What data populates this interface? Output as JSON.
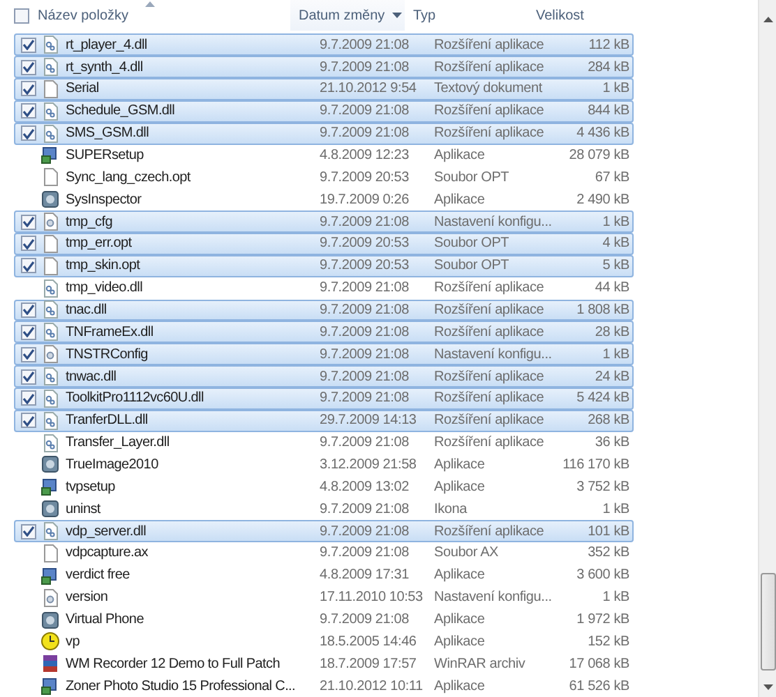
{
  "columns": [
    {
      "label": "Název položky",
      "sorted": true,
      "checked": false
    },
    {
      "label": "Datum změny",
      "hover": true
    },
    {
      "label": "Typ"
    },
    {
      "label": "Velikost"
    }
  ],
  "rows": [
    {
      "name": "rt_player_4.dll",
      "date": "9.7.2009 21:08",
      "type": "Rozšíření aplikace",
      "size": "112 kB",
      "kind": "dll",
      "selected": true
    },
    {
      "name": "rt_synth_4.dll",
      "date": "9.7.2009 21:08",
      "type": "Rozšíření aplikace",
      "size": "284 kB",
      "kind": "dll",
      "selected": true
    },
    {
      "name": "Serial",
      "date": "21.10.2012 9:54",
      "type": "Textový dokument",
      "size": "1 kB",
      "kind": "doc",
      "selected": true
    },
    {
      "name": "Schedule_GSM.dll",
      "date": "9.7.2009 21:08",
      "type": "Rozšíření aplikace",
      "size": "844 kB",
      "kind": "dll",
      "selected": true
    },
    {
      "name": "SMS_GSM.dll",
      "date": "9.7.2009 21:08",
      "type": "Rozšíření aplikace",
      "size": "4 436 kB",
      "kind": "dll",
      "selected": true
    },
    {
      "name": "SUPERsetup",
      "date": "4.8.2009 12:23",
      "type": "Aplikace",
      "size": "28 079 kB",
      "kind": "setup",
      "selected": false
    },
    {
      "name": "Sync_lang_czech.opt",
      "date": "9.7.2009 20:53",
      "type": "Soubor OPT",
      "size": "67 kB",
      "kind": "doc",
      "selected": false
    },
    {
      "name": "SysInspector",
      "date": "19.7.2009 0:26",
      "type": "Aplikace",
      "size": "2 490 kB",
      "kind": "app",
      "selected": false
    },
    {
      "name": "tmp_cfg",
      "date": "9.7.2009 21:08",
      "type": "Nastavení konfigu...",
      "size": "1 kB",
      "kind": "config",
      "selected": true
    },
    {
      "name": "tmp_err.opt",
      "date": "9.7.2009 20:53",
      "type": "Soubor OPT",
      "size": "4 kB",
      "kind": "doc",
      "selected": true
    },
    {
      "name": "tmp_skin.opt",
      "date": "9.7.2009 20:53",
      "type": "Soubor OPT",
      "size": "5 kB",
      "kind": "doc",
      "selected": true
    },
    {
      "name": "tmp_video.dll",
      "date": "9.7.2009 21:08",
      "type": "Rozšíření aplikace",
      "size": "44 kB",
      "kind": "dll",
      "selected": false
    },
    {
      "name": "tnac.dll",
      "date": "9.7.2009 21:08",
      "type": "Rozšíření aplikace",
      "size": "1 808 kB",
      "kind": "dll",
      "selected": true
    },
    {
      "name": "TNFrameEx.dll",
      "date": "9.7.2009 21:08",
      "type": "Rozšíření aplikace",
      "size": "28 kB",
      "kind": "dll",
      "selected": true
    },
    {
      "name": "TNSTRConfig",
      "date": "9.7.2009 21:08",
      "type": "Nastavení konfigu...",
      "size": "1 kB",
      "kind": "config",
      "selected": true
    },
    {
      "name": "tnwac.dll",
      "date": "9.7.2009 21:08",
      "type": "Rozšíření aplikace",
      "size": "24 kB",
      "kind": "dll",
      "selected": true
    },
    {
      "name": "ToolkitPro1112vc60U.dll",
      "date": "9.7.2009 21:08",
      "type": "Rozšíření aplikace",
      "size": "5 424 kB",
      "kind": "dll",
      "selected": true
    },
    {
      "name": "TranferDLL.dll",
      "date": "29.7.2009 14:13",
      "type": "Rozšíření aplikace",
      "size": "268 kB",
      "kind": "dll",
      "selected": true
    },
    {
      "name": "Transfer_Layer.dll",
      "date": "9.7.2009 21:08",
      "type": "Rozšíření aplikace",
      "size": "36 kB",
      "kind": "dll",
      "selected": false
    },
    {
      "name": "TrueImage2010",
      "date": "3.12.2009 21:58",
      "type": "Aplikace",
      "size": "116 170 kB",
      "kind": "app",
      "selected": false
    },
    {
      "name": "tvpsetup",
      "date": "4.8.2009 13:02",
      "type": "Aplikace",
      "size": "3 752 kB",
      "kind": "setup",
      "selected": false
    },
    {
      "name": "uninst",
      "date": "9.7.2009 21:08",
      "type": "Ikona",
      "size": "1 kB",
      "kind": "app",
      "selected": false
    },
    {
      "name": "vdp_server.dll",
      "date": "9.7.2009 21:08",
      "type": "Rozšíření aplikace",
      "size": "101 kB",
      "kind": "dll",
      "selected": true
    },
    {
      "name": "vdpcapture.ax",
      "date": "9.7.2009 21:08",
      "type": "Soubor AX",
      "size": "352 kB",
      "kind": "doc",
      "selected": false
    },
    {
      "name": "verdict free",
      "date": "4.8.2009 17:31",
      "type": "Aplikace",
      "size": "3 600 kB",
      "kind": "setup",
      "selected": false
    },
    {
      "name": "version",
      "date": "17.11.2010 10:53",
      "type": "Nastavení konfigu...",
      "size": "1 kB",
      "kind": "config",
      "selected": false
    },
    {
      "name": "Virtual Phone",
      "date": "9.7.2009 21:08",
      "type": "Aplikace",
      "size": "1 972 kB",
      "kind": "app",
      "selected": false
    },
    {
      "name": "vp",
      "date": "18.5.2005 14:46",
      "type": "Aplikace",
      "size": "152 kB",
      "kind": "clock",
      "selected": false
    },
    {
      "name": "WM Recorder 12 Demo to Full Patch",
      "date": "18.7.2009 17:57",
      "type": "WinRAR archiv",
      "size": "17 068 kB",
      "kind": "archive",
      "selected": false
    },
    {
      "name": "Zoner Photo Studio 15 Professional C...",
      "date": "21.10.2012 10:11",
      "type": "Aplikace",
      "size": "61 526 kB",
      "kind": "setup",
      "selected": false
    }
  ]
}
